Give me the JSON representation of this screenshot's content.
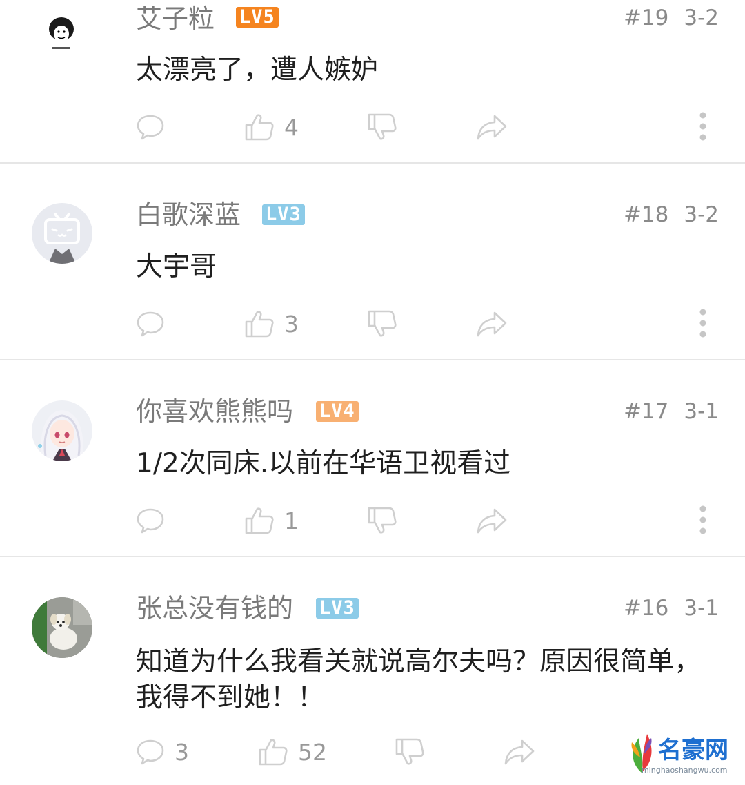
{
  "comments": [
    {
      "name": "艾子粒",
      "level": "LV5",
      "floor": "#19",
      "date": "3-2",
      "text": "太漂亮了，遭人嫉妒",
      "reply_count": "",
      "like_count": "4",
      "avatar": "meme-face-avatar",
      "level_color": "#f5841f"
    },
    {
      "name": "白歌深蓝",
      "level": "LV3",
      "floor": "#18",
      "date": "3-2",
      "text": "大宇哥",
      "reply_count": "",
      "like_count": "3",
      "avatar": "default-tv-avatar",
      "level_color": "#8ccbe8"
    },
    {
      "name": "你喜欢熊熊吗",
      "level": "LV4",
      "floor": "#17",
      "date": "3-1",
      "text": "1/2次同床.以前在华语卫视看过",
      "reply_count": "",
      "like_count": "1",
      "avatar": "anime-girl-avatar",
      "level_color": "#f8b072"
    },
    {
      "name": "张总没有钱的",
      "level": "LV3",
      "floor": "#16",
      "date": "3-1",
      "text": "知道为什么我看关就说高尔夫吗？原因很简单，我得不到她！！",
      "reply_count": "3",
      "like_count": "52",
      "avatar": "puppy-avatar",
      "level_color": "#8ccbe8"
    }
  ],
  "icons": {
    "reply": "comment-bubble-icon",
    "like": "thumbs-up-icon",
    "dislike": "thumbs-down-icon",
    "share": "share-arrow-icon",
    "more": "more-vertical-icon"
  },
  "watermark": {
    "text": "名豪网",
    "url": "minghaoshangwu.com"
  }
}
